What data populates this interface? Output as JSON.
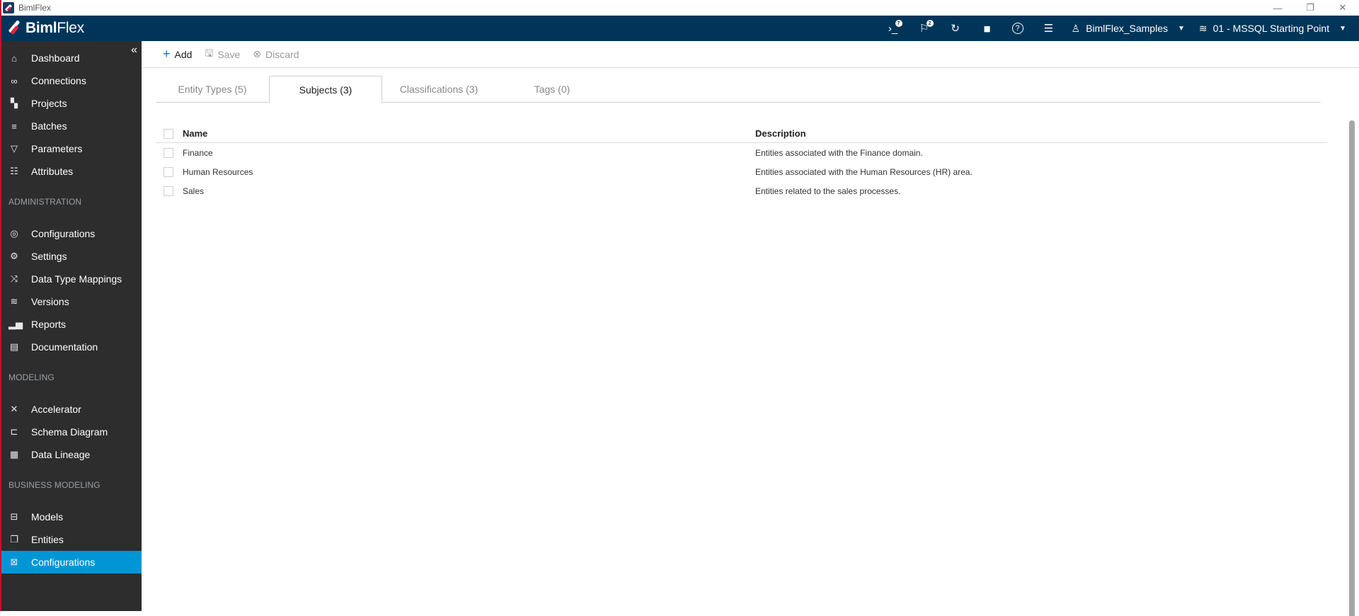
{
  "window": {
    "title": "BimlFlex",
    "controls": {
      "minimize": "—",
      "restore": "❐",
      "close": "✕"
    }
  },
  "topbar": {
    "brand_bold": "Biml",
    "brand_light": "Flex",
    "icons": [
      {
        "name": "console-icon",
        "glyph": "›_",
        "badge": "7"
      },
      {
        "name": "flag-icon",
        "glyph": "⚐",
        "badge": "2"
      },
      {
        "name": "refresh-icon",
        "glyph": "↻",
        "badge": null
      },
      {
        "name": "chart-icon",
        "glyph": "▮▮",
        "badge": null
      },
      {
        "name": "help-icon",
        "glyph": "?",
        "badge": null
      },
      {
        "name": "server-icon",
        "glyph": "☰",
        "badge": null
      }
    ],
    "customer": {
      "icon": "user-icon",
      "label": "BimlFlex_Samples"
    },
    "version": {
      "icon": "layers-icon",
      "label": "01 - MSSQL Starting Point"
    }
  },
  "sidebar": {
    "collapse_glyph": "«",
    "items": [
      {
        "label": "Dashboard",
        "icon": "⌂",
        "icon_name": "home-icon"
      },
      {
        "label": "Connections",
        "icon": "∞",
        "icon_name": "link-icon"
      },
      {
        "label": "Projects",
        "icon": "▚",
        "icon_name": "projects-icon"
      },
      {
        "label": "Batches",
        "icon": "≡",
        "icon_name": "batches-icon"
      },
      {
        "label": "Parameters",
        "icon": "▽",
        "icon_name": "parameters-icon"
      },
      {
        "label": "Attributes",
        "icon": "☷",
        "icon_name": "attributes-icon"
      }
    ],
    "sections": [
      {
        "title": "ADMINISTRATION",
        "items": [
          {
            "label": "Configurations",
            "icon": "◎",
            "icon_name": "configurations-icon"
          },
          {
            "label": "Settings",
            "icon": "⚙",
            "icon_name": "settings-icon"
          },
          {
            "label": "Data Type Mappings",
            "icon": "⤨",
            "icon_name": "shuffle-icon"
          },
          {
            "label": "Versions",
            "icon": "≋",
            "icon_name": "versions-icon"
          },
          {
            "label": "Reports",
            "icon": "▂▅",
            "icon_name": "reports-icon"
          },
          {
            "label": "Documentation",
            "icon": "▤",
            "icon_name": "documentation-icon"
          }
        ]
      },
      {
        "title": "MODELING",
        "items": [
          {
            "label": "Accelerator",
            "icon": "✕",
            "icon_name": "accelerator-icon"
          },
          {
            "label": "Schema Diagram",
            "icon": "⊏",
            "icon_name": "schema-diagram-icon"
          },
          {
            "label": "Data Lineage",
            "icon": "▦",
            "icon_name": "data-lineage-icon"
          }
        ]
      },
      {
        "title": "BUSINESS MODELING",
        "items": [
          {
            "label": "Models",
            "icon": "⊟",
            "icon_name": "models-icon"
          },
          {
            "label": "Entities",
            "icon": "❐",
            "icon_name": "entities-icon"
          },
          {
            "label": "Configurations",
            "icon": "⊠",
            "icon_name": "business-configurations-icon",
            "active": true
          }
        ]
      }
    ]
  },
  "toolbar": {
    "add": "Add",
    "save": "Save",
    "discard": "Discard"
  },
  "tabs": [
    {
      "label": "Entity Types (5)",
      "active": false
    },
    {
      "label": "Subjects (3)",
      "active": true
    },
    {
      "label": "Classifications (3)",
      "active": false
    },
    {
      "label": "Tags (0)",
      "active": false
    }
  ],
  "grid": {
    "columns": [
      "Name",
      "Description"
    ],
    "rows": [
      {
        "name": "Finance",
        "description": "Entities associated with the Finance domain."
      },
      {
        "name": "Human Resources",
        "description": "Entities associated with the Human Resources (HR) area."
      },
      {
        "name": "Sales",
        "description": "Entities related to the sales processes."
      }
    ]
  },
  "colors": {
    "topbar": "#00355a",
    "sidebar": "#2d2d2d",
    "active_item": "#0096d6",
    "accent_red": "#e3263f"
  }
}
